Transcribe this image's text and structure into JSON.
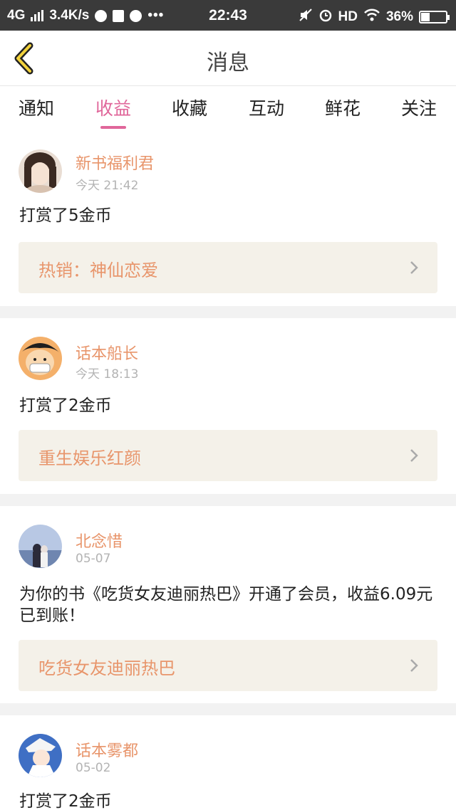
{
  "statusbar": {
    "network": "4G",
    "speed": "3.4K/s",
    "time": "22:43",
    "hd": "HD",
    "battery": "36%",
    "battery_level": 0.36
  },
  "header": {
    "title": "消息"
  },
  "tabs": [
    {
      "label": "通知",
      "active": false
    },
    {
      "label": "收益",
      "active": true
    },
    {
      "label": "收藏",
      "active": false
    },
    {
      "label": "互动",
      "active": false
    },
    {
      "label": "鲜花",
      "active": false
    },
    {
      "label": "关注",
      "active": false
    }
  ],
  "colors": {
    "accent": "#e0669a",
    "name": "#e8956b",
    "book_bg": "#f4f1e9"
  },
  "messages": [
    {
      "user": "新书福利君",
      "time": "今天 21:42",
      "text": "打赏了5金币",
      "book": "热销：神仙恋爱"
    },
    {
      "user": "话本船长",
      "time": "今天 18:13",
      "text": "打赏了2金币",
      "book": "重生娱乐红颜"
    },
    {
      "user": "北念惜",
      "time": "05-07",
      "text": "为你的书《吃货女友迪丽热巴》开通了会员，收益6.09元已到账！",
      "book": "吃货女友迪丽热巴"
    },
    {
      "user": "话本雾都",
      "time": "05-02",
      "text": "打赏了2金币",
      "book": ""
    }
  ]
}
